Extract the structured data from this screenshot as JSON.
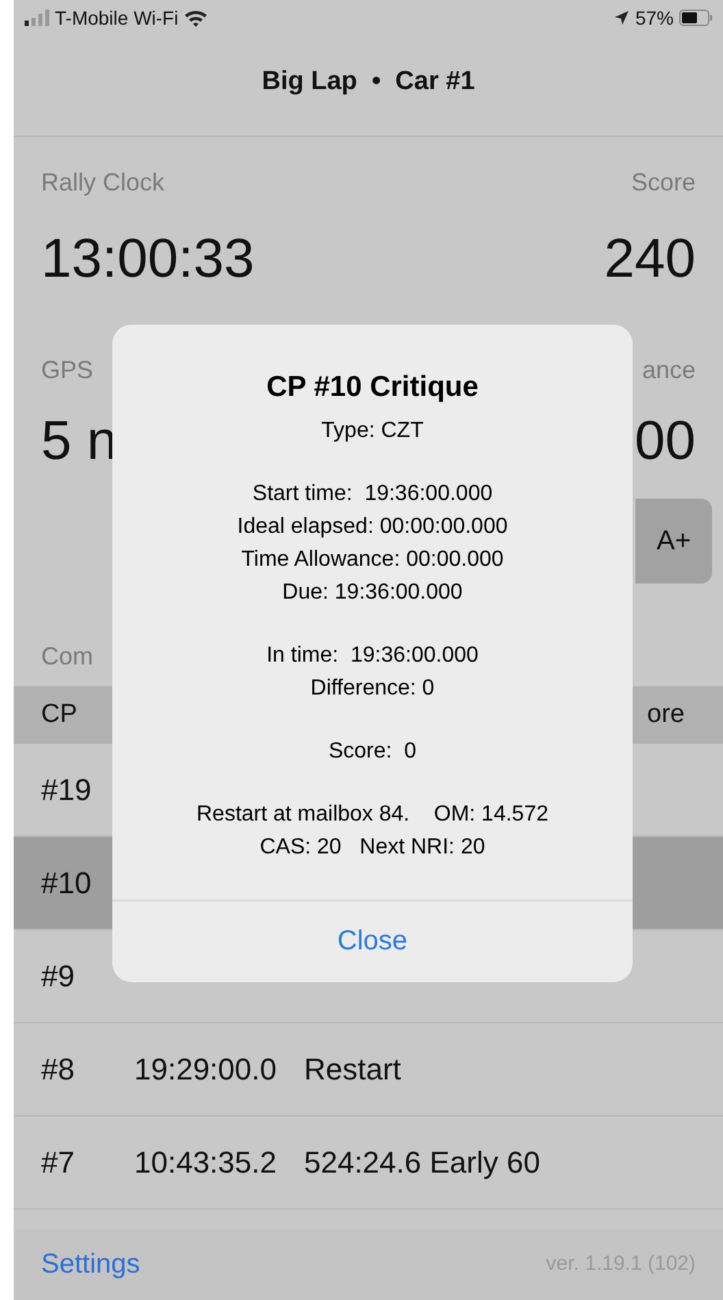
{
  "status_bar": {
    "carrier": "T-Mobile Wi-Fi",
    "battery": "57%"
  },
  "nav": {
    "title": "Big Lap  •  Car #1"
  },
  "stats": [
    {
      "label": "Rally Clock",
      "value": "13:00:33"
    },
    {
      "label": "Score",
      "value": "240"
    }
  ],
  "stats_hidden": [
    {
      "label": "GPS",
      "value": "5 n"
    },
    {
      "label": "ance",
      "value": "00"
    }
  ],
  "button_fragment": "A+",
  "section_label": "Com",
  "table": {
    "columns": [
      "CP",
      "ore"
    ],
    "rows": [
      {
        "cp": "#19",
        "selected": false
      },
      {
        "cp": "#10",
        "selected": true
      },
      {
        "cp": "#9",
        "selected": false
      },
      {
        "cp": "#8",
        "time": "19:29:00.0",
        "result": "Restart",
        "selected": false
      },
      {
        "cp": "#7",
        "time": "10:43:35.2",
        "result": "524:24.6 Early 60",
        "selected": false
      }
    ]
  },
  "toolbar": {
    "settings": "Settings",
    "version": "ver. 1.19.1 (102)"
  },
  "dialog": {
    "title": "CP #10 Critique",
    "groups": [
      [
        "Type: CZT"
      ],
      [
        "Start time:  19:36:00.000",
        "Ideal elapsed: 00:00:00.000",
        "Time Allowance: 00:00.000",
        "Due: 19:36:00.000"
      ],
      [
        "In time:  19:36:00.000",
        "Difference: 0"
      ],
      [
        "Score:  0"
      ],
      [
        "Restart at mailbox 84.    OM: 14.572   CAS: 20   Next NRI: 20"
      ]
    ],
    "button": "Close"
  }
}
